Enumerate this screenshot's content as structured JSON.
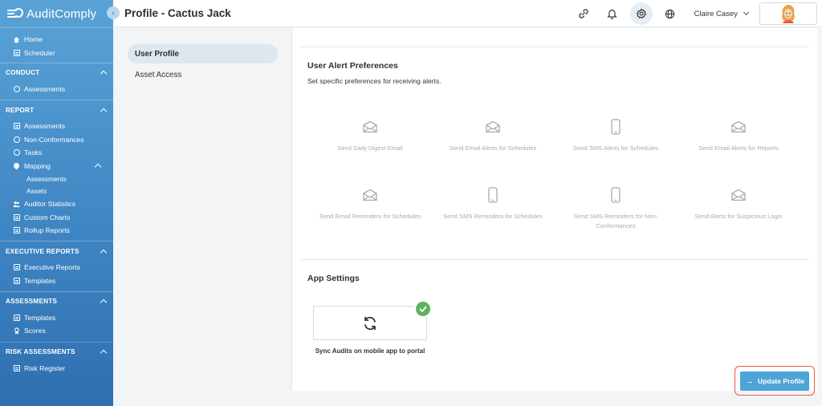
{
  "app": {
    "brand": "AuditComply"
  },
  "sidebar": {
    "top_items": [
      {
        "label": "Home",
        "icon": "home-icon"
      },
      {
        "label": "Scheduler",
        "icon": "calendar-icon"
      }
    ],
    "sections": [
      {
        "title": "CONDUCT",
        "items": [
          {
            "label": "Assessments",
            "icon": "clock-icon"
          }
        ]
      },
      {
        "title": "REPORT",
        "items": [
          {
            "label": "Assessments",
            "icon": "list-icon"
          },
          {
            "label": "Non-Conformances",
            "icon": "search-icon"
          },
          {
            "label": "Tasks",
            "icon": "target-icon"
          },
          {
            "label": "Mapping",
            "icon": "map-pin-icon"
          },
          {
            "label": "Assessments",
            "sub": true
          },
          {
            "label": "Assets",
            "sub": true
          },
          {
            "label": "Auditor Statistics",
            "icon": "users-icon"
          },
          {
            "label": "Custom Charts",
            "icon": "chart-icon"
          },
          {
            "label": "Rollup Reports",
            "icon": "chart-icon"
          }
        ]
      },
      {
        "title": "EXECUTIVE REPORTS",
        "items": [
          {
            "label": "Executive Reports",
            "icon": "list-icon"
          },
          {
            "label": "Templates",
            "icon": "edit-icon"
          }
        ]
      },
      {
        "title": "ASSESSMENTS",
        "items": [
          {
            "label": "Templates",
            "icon": "edit-icon"
          },
          {
            "label": "Scores",
            "icon": "award-icon"
          }
        ]
      },
      {
        "title": "RISK ASSESSMENTS",
        "items": [
          {
            "label": "Risk Register",
            "icon": "list-icon"
          }
        ]
      }
    ]
  },
  "header": {
    "title": "Profile - Cactus Jack",
    "user_name": "Claire Casey"
  },
  "subnav": {
    "items": [
      {
        "label": "User Profile",
        "active": true
      },
      {
        "label": "Asset Access",
        "active": false
      }
    ]
  },
  "alerts": {
    "title": "User Alert Preferences",
    "subtitle": "Set specific preferences for receiving alerts.",
    "items": [
      {
        "label": "Send Daily Digest Email",
        "icon": "envelope-icon"
      },
      {
        "label": "Send Email Alerts for Schedules",
        "icon": "envelope-icon"
      },
      {
        "label": "Send SMS Alerts for Schedules",
        "icon": "phone-icon"
      },
      {
        "label": "Send Email Alerts for Reports",
        "icon": "envelope-icon"
      },
      {
        "label": "Send Email Reminders for Schedules",
        "icon": "envelope-icon"
      },
      {
        "label": "Send SMS Reminders for Schedules",
        "icon": "phone-icon"
      },
      {
        "label": "Send SMS Reminders for Non-Conformances",
        "icon": "phone-icon"
      },
      {
        "label": "Send Alerts for Suspicious Login",
        "icon": "envelope-icon"
      }
    ]
  },
  "app_settings": {
    "title": "App Settings",
    "sync_label": "Sync Audits on mobile app to portal",
    "sync_enabled": true
  },
  "actions": {
    "update_label": "Update Profile"
  },
  "colors": {
    "sidebar_top": "#5aa3d6",
    "sidebar_bottom": "#2f6fb0",
    "primary_button": "#4da4d6",
    "highlight_border": "#e25a4e",
    "check_green": "#5db35c"
  }
}
